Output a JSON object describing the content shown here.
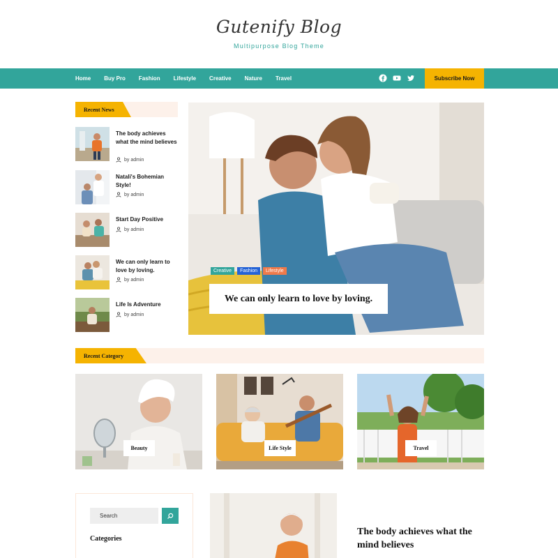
{
  "header": {
    "logo": "Gutenify Blog",
    "tagline": "Multipurpose Blog Theme"
  },
  "nav": {
    "items": [
      "Home",
      "Buy Pro",
      "Fashion",
      "Lifestyle",
      "Creative",
      "Nature",
      "Travel"
    ],
    "social": [
      "facebook-icon",
      "youtube-icon",
      "twitter-icon"
    ],
    "subscribe_label": "Subscribe Now"
  },
  "recent_news": {
    "heading": "Recent News",
    "items": [
      {
        "title": "The body achieves what the mind believes",
        "author": "by admin"
      },
      {
        "title": "Natali's Bohemian Style!",
        "author": "by admin"
      },
      {
        "title": "Start Day Positive",
        "author": "by admin"
      },
      {
        "title": "We can only learn to love by loving.",
        "author": "by admin"
      },
      {
        "title": "Life Is Adventure",
        "author": "by admin"
      }
    ]
  },
  "hero": {
    "tags": [
      "Creative",
      "Fashion",
      "Lifestyle"
    ],
    "title": "We can only learn to love by loving."
  },
  "recent_category": {
    "heading": "Recent Category",
    "cards": [
      {
        "label": "Beauty"
      },
      {
        "label": "Life Style"
      },
      {
        "label": "Travel"
      }
    ]
  },
  "sidebar": {
    "search_placeholder": "Search",
    "categories_heading": "Categories"
  },
  "featured": {
    "title": "The body achieves what the mind believes"
  },
  "colors": {
    "accent": "#32a59b",
    "highlight": "#f5b301",
    "tag_creative": "#32a59b",
    "tag_fashion": "#2563d6",
    "tag_lifestyle": "#f07a4a"
  }
}
